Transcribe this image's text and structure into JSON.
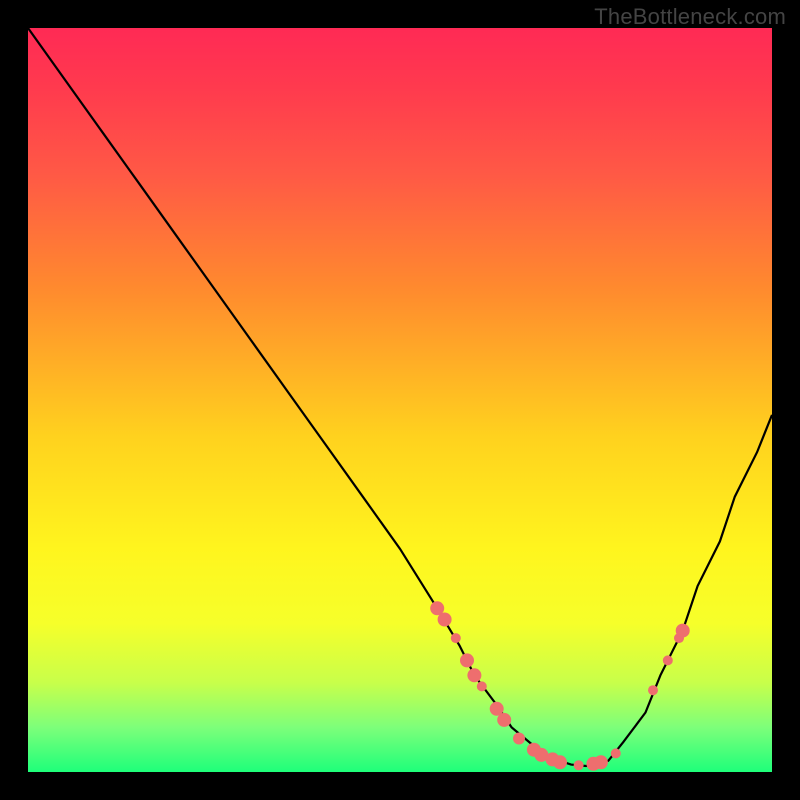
{
  "watermark": "TheBottleneck.com",
  "colors": {
    "background": "#000000",
    "gradient_top": "#ff2a55",
    "gradient_bottom": "#1eff7a",
    "curve": "#000000",
    "marker": "#ee6e6e"
  },
  "chart_data": {
    "type": "line",
    "title": "",
    "xlabel": "",
    "ylabel": "",
    "xlim": [
      0,
      100
    ],
    "ylim": [
      0,
      100
    ],
    "series": [
      {
        "name": "bottleneck-curve",
        "x": [
          0,
          5,
          10,
          15,
          20,
          25,
          30,
          35,
          40,
          45,
          50,
          55,
          58,
          60,
          63,
          65,
          68,
          70,
          73,
          75,
          78,
          80,
          83,
          85,
          88,
          90,
          93,
          95,
          98,
          100
        ],
        "values": [
          100,
          93,
          86,
          79,
          72,
          65,
          58,
          51,
          44,
          37,
          30,
          22,
          17,
          13,
          9,
          6,
          3.5,
          2,
          1,
          0.8,
          1.5,
          4,
          8,
          13,
          19,
          25,
          31,
          37,
          43,
          48
        ]
      }
    ],
    "markers": [
      {
        "x": 55.0,
        "y": 22.0,
        "r": 7
      },
      {
        "x": 56.0,
        "y": 20.5,
        "r": 7
      },
      {
        "x": 57.5,
        "y": 18.0,
        "r": 5
      },
      {
        "x": 59.0,
        "y": 15.0,
        "r": 7
      },
      {
        "x": 60.0,
        "y": 13.0,
        "r": 7
      },
      {
        "x": 61.0,
        "y": 11.5,
        "r": 5
      },
      {
        "x": 63.0,
        "y": 8.5,
        "r": 7
      },
      {
        "x": 64.0,
        "y": 7.0,
        "r": 7
      },
      {
        "x": 66.0,
        "y": 4.5,
        "r": 6
      },
      {
        "x": 68.0,
        "y": 3.0,
        "r": 7
      },
      {
        "x": 69.0,
        "y": 2.3,
        "r": 7
      },
      {
        "x": 70.5,
        "y": 1.7,
        "r": 7
      },
      {
        "x": 71.5,
        "y": 1.3,
        "r": 7
      },
      {
        "x": 74.0,
        "y": 0.9,
        "r": 5
      },
      {
        "x": 76.0,
        "y": 1.1,
        "r": 7
      },
      {
        "x": 77.0,
        "y": 1.3,
        "r": 7
      },
      {
        "x": 79.0,
        "y": 2.5,
        "r": 5
      },
      {
        "x": 84.0,
        "y": 11.0,
        "r": 5
      },
      {
        "x": 86.0,
        "y": 15.0,
        "r": 5
      },
      {
        "x": 87.5,
        "y": 18.0,
        "r": 5
      },
      {
        "x": 88.0,
        "y": 19.0,
        "r": 7
      }
    ]
  }
}
